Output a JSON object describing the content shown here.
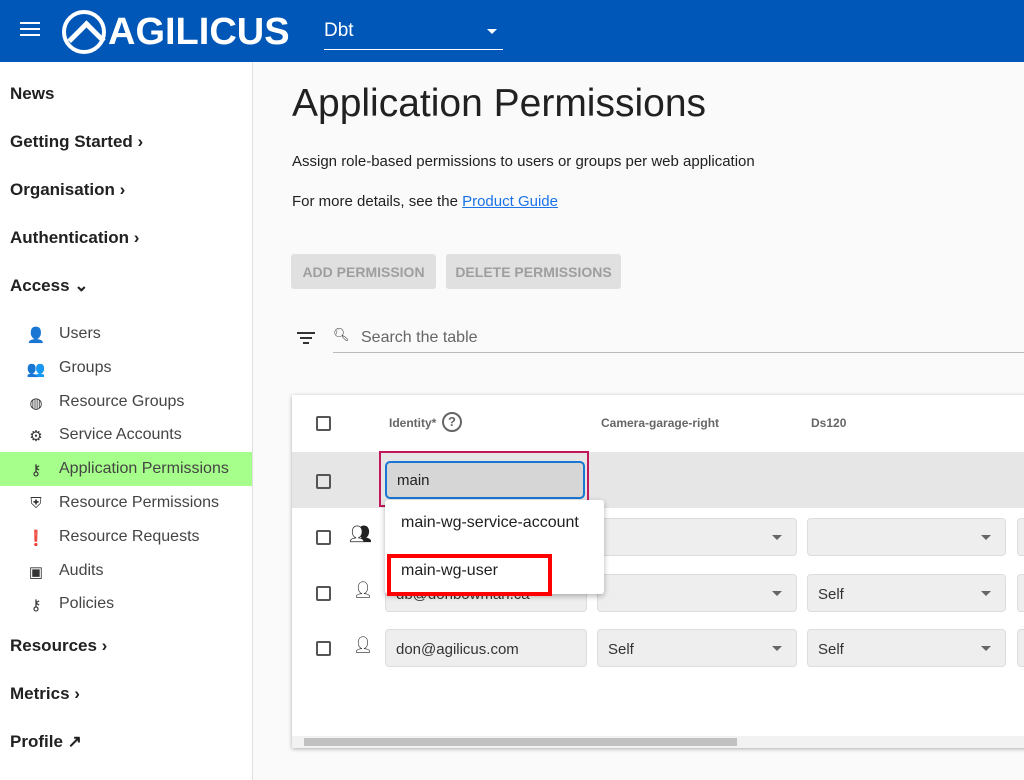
{
  "header": {
    "brand": "AGILICUS",
    "org": "Dbt"
  },
  "sidebar": {
    "items": [
      {
        "label": "News",
        "chev": ""
      },
      {
        "label": "Getting Started",
        "chev": "›"
      },
      {
        "label": "Organisation",
        "chev": "›"
      },
      {
        "label": "Authentication",
        "chev": "›"
      },
      {
        "label": "Access",
        "chev": "⌄"
      }
    ],
    "sub": [
      {
        "label": "Users",
        "icon": "person-icon",
        "glyph": "👤"
      },
      {
        "label": "Groups",
        "icon": "groups-icon",
        "glyph": "👥"
      },
      {
        "label": "Resource Groups",
        "icon": "resource-groups-icon",
        "glyph": "◍"
      },
      {
        "label": "Service Accounts",
        "icon": "gears-icon",
        "glyph": "⚙"
      },
      {
        "label": "Application Permissions",
        "icon": "key-icon",
        "glyph": "⚷"
      },
      {
        "label": "Resource Permissions",
        "icon": "shield-icon",
        "glyph": "⛨"
      },
      {
        "label": "Resource Requests",
        "icon": "clipboard-alert-icon",
        "glyph": "❗"
      },
      {
        "label": "Audits",
        "icon": "briefcase-icon",
        "glyph": "▣"
      },
      {
        "label": "Policies",
        "icon": "key-icon",
        "glyph": "⚷"
      }
    ],
    "bottom": [
      {
        "label": "Resources",
        "chev": "›"
      },
      {
        "label": "Metrics",
        "chev": "›"
      },
      {
        "label": "Profile",
        "chev": "↗"
      }
    ]
  },
  "main": {
    "title": "Application Permissions",
    "desc": "Assign role-based permissions to users or groups per web application",
    "details_prefix": "For more details, see the ",
    "details_link": "Product Guide",
    "add_btn": "ADD PERMISSION",
    "delete_btn": "DELETE PERMISSIONS",
    "search_placeholder": "Search the table"
  },
  "table": {
    "headers": [
      "Identity*",
      "Camera-garage-right",
      "Ds120"
    ],
    "edit_value": "main",
    "rows": [
      {
        "type": "group",
        "identity": "",
        "c1": "",
        "c2": ""
      },
      {
        "type": "user",
        "identity": "db@donbowman.ca",
        "c1": "",
        "c2": "Self"
      },
      {
        "type": "user",
        "identity": "don@agilicus.com",
        "c1": "Self",
        "c2": "Self"
      }
    ],
    "options": [
      "main-wg-service-account",
      "main-wg-user"
    ]
  },
  "colors": {
    "header": "#0057b8",
    "active_nav": "#a6ff8a",
    "highlight": "#ff0000"
  }
}
